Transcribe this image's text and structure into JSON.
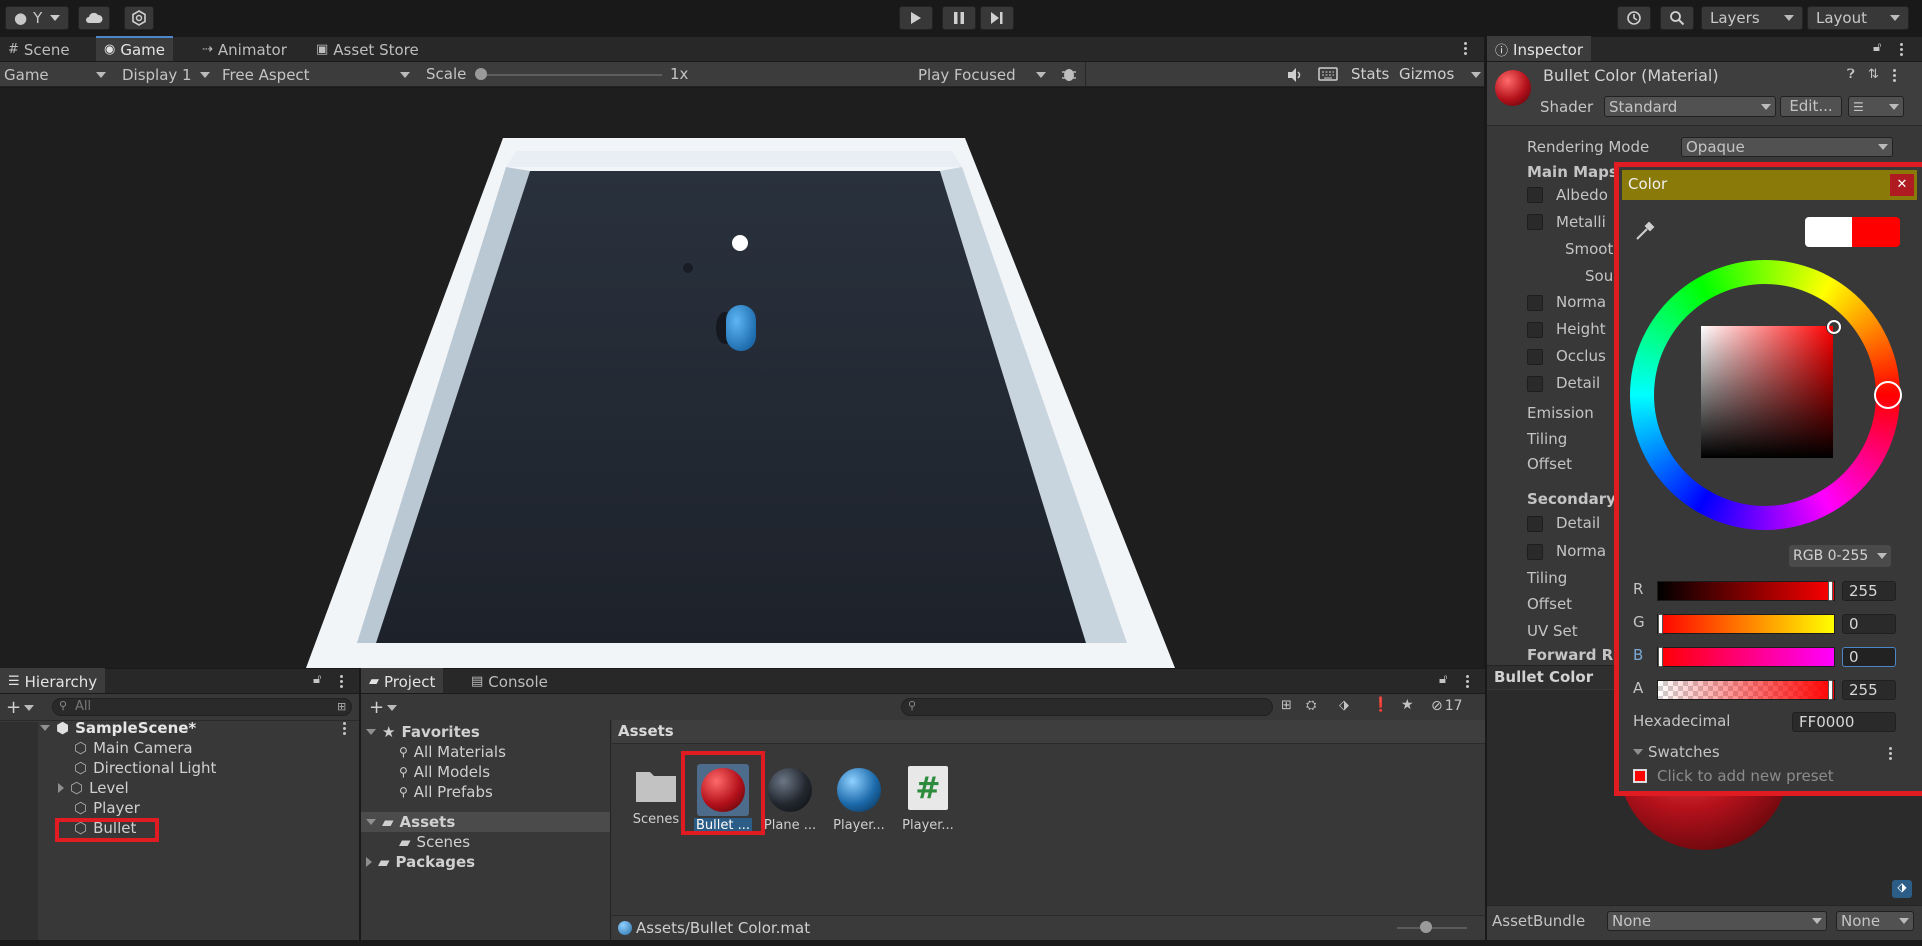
{
  "toolbar": {
    "account_label": "Y",
    "layers_label": "Layers",
    "layout_label": "Layout"
  },
  "game_view": {
    "tabs": [
      "Scene",
      "Game",
      "Animator",
      "Asset Store"
    ],
    "game_dropdown": "Game",
    "display_dropdown": "Display 1",
    "aspect_dropdown": "Free Aspect",
    "scale_label": "Scale",
    "scale_value": "1x",
    "play_focused": "Play Focused",
    "stats_label": "Stats",
    "gizmos_label": "Gizmos"
  },
  "hierarchy": {
    "title": "Hierarchy",
    "search_placeholder": "All",
    "scene_name": "SampleScene*",
    "items": [
      "Main Camera",
      "Directional Light",
      "Level",
      "Player",
      "Bullet"
    ]
  },
  "project": {
    "tabs": [
      "Project",
      "Console"
    ],
    "favorites_label": "Favorites",
    "favorites": [
      "All Materials",
      "All Models",
      "All Prefabs"
    ],
    "assets_label": "Assets",
    "assets_children": [
      "Scenes"
    ],
    "packages_label": "Packages",
    "breadcrumb": "Assets",
    "hidden_count": "17",
    "asset_items": [
      "Scenes",
      "Bullet ...",
      "Plane ...",
      "Player...",
      "Player..."
    ],
    "status_path": "Assets/Bullet Color.mat"
  },
  "inspector": {
    "title": "Inspector",
    "material_name": "Bullet Color (Material)",
    "shader_label": "Shader",
    "shader_value": "Standard",
    "edit_button": "Edit...",
    "rendering_mode_label": "Rendering Mode",
    "rendering_mode_value": "Opaque",
    "main_maps": "Main Maps",
    "rows": [
      "Albedo",
      "Metalli",
      "Smoot",
      "Sou",
      "Norma",
      "Height",
      "Occlus",
      "Detail"
    ],
    "emission": "Emission",
    "tiling": "Tiling",
    "offset": "Offset",
    "secondary": "Secondary",
    "sec_rows": [
      "Detail",
      "Norma"
    ],
    "tiling2": "Tiling",
    "offset2": "Offset",
    "uv_set": "UV Set",
    "forward": "Forward Re",
    "preview_title": "Bullet Color",
    "assetbundle_label": "AssetBundle",
    "assetbundle_value": "None",
    "assetbundle_variant": "None"
  },
  "color_picker": {
    "title": "Color",
    "mode": "RGB 0-255",
    "channels": [
      {
        "label": "R",
        "value": "255",
        "fraction": 1.0
      },
      {
        "label": "G",
        "value": "0",
        "fraction": 0.0
      },
      {
        "label": "B",
        "value": "0",
        "fraction": 0.0
      },
      {
        "label": "A",
        "value": "255",
        "fraction": 1.0
      }
    ],
    "hex_label": "Hexadecimal",
    "hex_value": "FF0000",
    "swatches_label": "Swatches",
    "add_preset": "Click to add new preset",
    "current_color": "#ff0000"
  },
  "colors": {
    "accent_red": "#e11b22",
    "selection_blue": "#2c5d87"
  }
}
